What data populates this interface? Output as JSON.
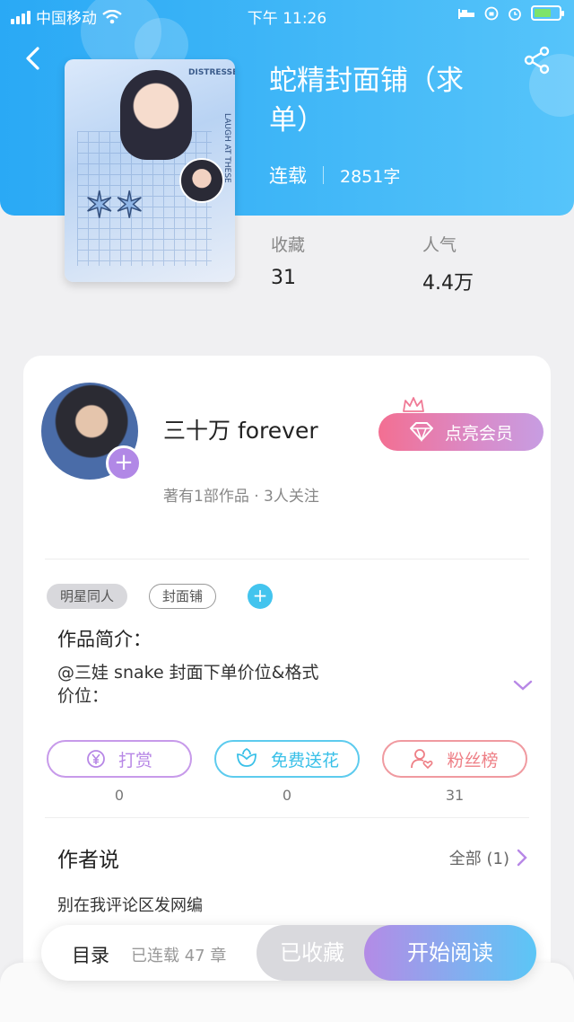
{
  "status_bar": {
    "carrier": "中国移动",
    "time": "下午 11:26"
  },
  "book": {
    "title": "蛇精封面铺（求单）",
    "status": "连载",
    "word_count": "2851字",
    "stats": [
      {
        "label": "收藏",
        "value": "31"
      },
      {
        "label": "人气",
        "value": "4.4万"
      }
    ],
    "cover_icon": "book-cover-image"
  },
  "author": {
    "name": "三十万 forever",
    "subtitle": "著有1部作品 · 3人关注",
    "vip_label": "点亮会员"
  },
  "tags": [
    "明星同人",
    "封面铺"
  ],
  "intro": {
    "label": "作品简介：",
    "line1": "@三娃 snake 封面下单价位&格式",
    "line2": "价位："
  },
  "actions": [
    {
      "label": "打赏",
      "count": "0",
      "color": "#b787e6"
    },
    {
      "label": "免费送花",
      "count": "0",
      "color": "#39c0e8"
    },
    {
      "label": "粉丝榜",
      "count": "31",
      "color": "#ee7f86"
    }
  ],
  "author_says": {
    "label": "作者说",
    "more": "全部 (1)",
    "text": "别在我评论区发网编"
  },
  "bottom_bar": {
    "toc": "目录",
    "serial": "已连载 47 章",
    "collected": "已收藏",
    "read": "开始阅读"
  },
  "colors": {
    "header_blue": "#2aa9f5",
    "purple": "#b787e6",
    "cyan": "#39c0e8",
    "pink": "#ee7f86"
  }
}
